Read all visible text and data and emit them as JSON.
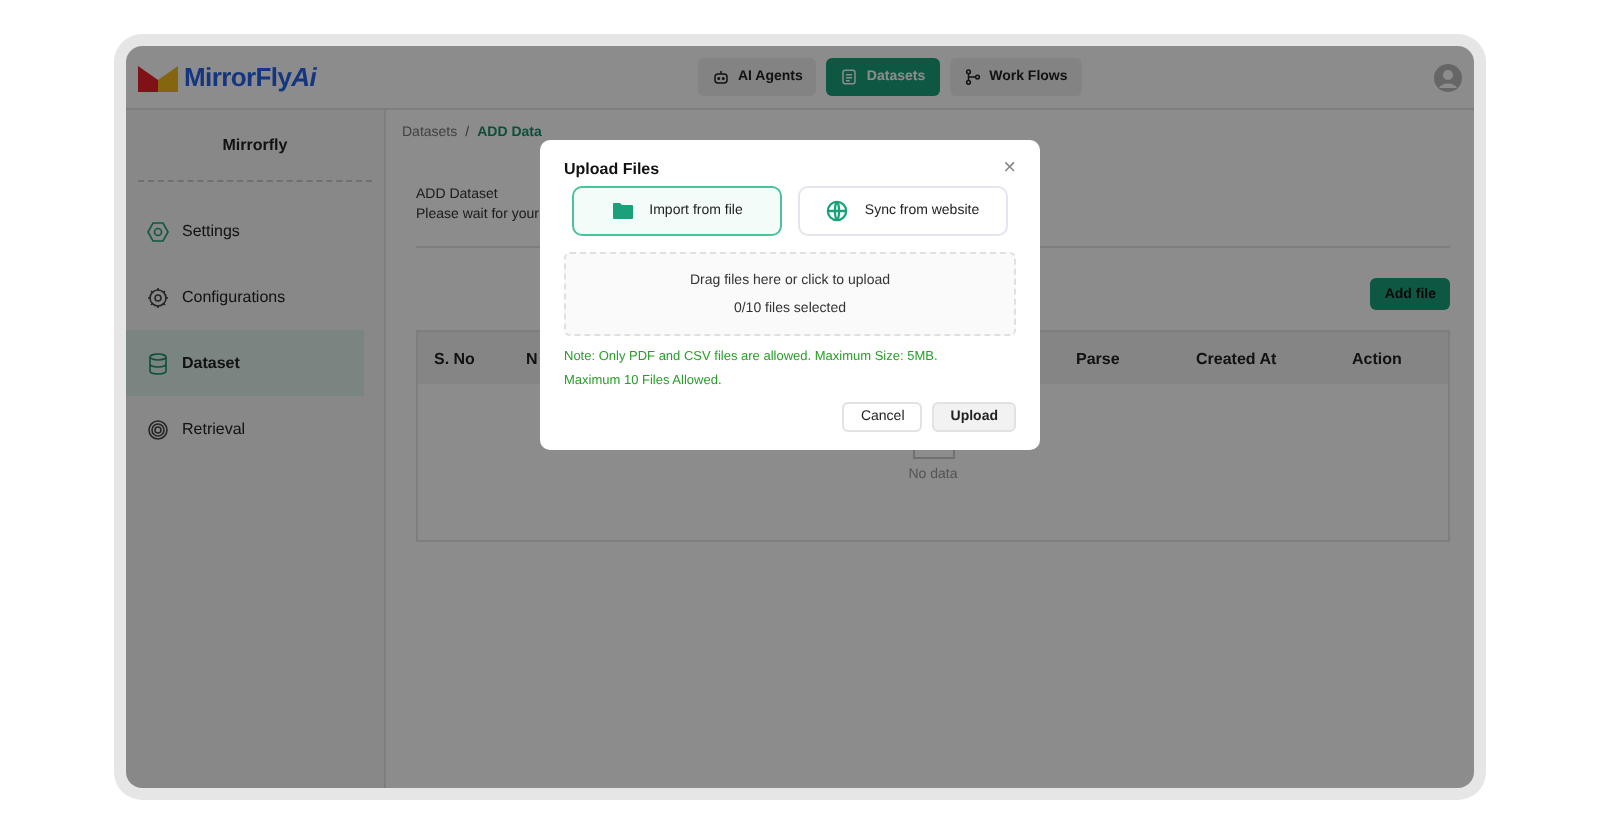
{
  "header": {
    "logo": {
      "name": "MirrorFly",
      "suffix": "Ai"
    },
    "nav": [
      {
        "label": "AI Agents",
        "kind": "robot",
        "selected": false
      },
      {
        "label": "Datasets",
        "kind": "doc",
        "selected": true
      },
      {
        "label": "Work Flows",
        "kind": "flow",
        "selected": false
      }
    ]
  },
  "sidebar": {
    "title": "Mirrorfly",
    "items": [
      {
        "label": "Settings",
        "kind": "settings",
        "selected": false
      },
      {
        "label": "Configurations",
        "kind": "config",
        "selected": false
      },
      {
        "label": "Dataset",
        "kind": "dataset",
        "selected": true
      },
      {
        "label": "Retrieval",
        "kind": "retrieval",
        "selected": false
      }
    ]
  },
  "breadcrumb": [
    {
      "label": "Datasets",
      "selected": false
    },
    {
      "label": "ADD Data",
      "selected": true
    }
  ],
  "breadcrumb_separator": "/",
  "intro": {
    "title": "ADD Dataset",
    "subtitle": "Please wait for your"
  },
  "add_button": "Add file",
  "table": {
    "columns": [
      {
        "label": "S. No"
      },
      {
        "label": "N"
      },
      {
        "label": "Parse"
      },
      {
        "label": "Created At"
      },
      {
        "label": "Action"
      }
    ],
    "empty": "No data"
  },
  "modal": {
    "title": "Upload Files",
    "close": "×",
    "options": [
      {
        "label": "Import from file",
        "kind": "folder",
        "selected": true
      },
      {
        "label": "Sync from website",
        "kind": "globe",
        "selected": false
      }
    ],
    "dropzone": {
      "hint": "Drag files here or click to upload",
      "count": "0/10 files selected"
    },
    "note": [
      "Note: Only PDF and CSV files are allowed. Maximum Size: 5MB.",
      "Maximum 10 Files Allowed."
    ],
    "buttons": [
      {
        "label": "Cancel",
        "kind": "secondary"
      },
      {
        "label": "Upload",
        "kind": "primary"
      }
    ]
  }
}
